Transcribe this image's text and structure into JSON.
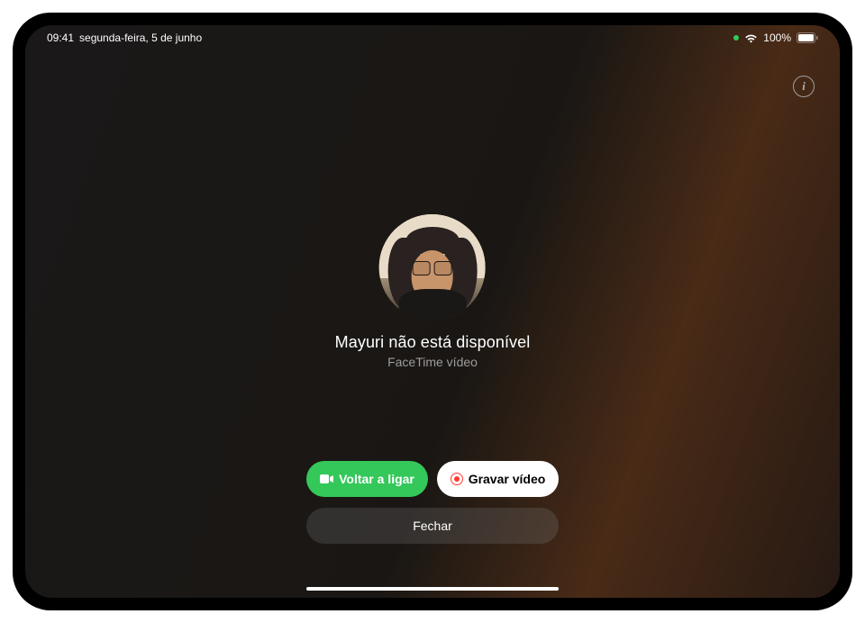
{
  "status_bar": {
    "time": "09:41",
    "date": "segunda-feira, 5 de junho",
    "battery_percent": "100%"
  },
  "call": {
    "unavailable_title": "Mayuri não está disponível",
    "subtitle": "FaceTime vídeo"
  },
  "buttons": {
    "call_again": "Voltar a ligar",
    "record_video": "Gravar vídeo",
    "close": "Fechar"
  },
  "colors": {
    "green": "#34C759",
    "red": "#ff3b30"
  }
}
